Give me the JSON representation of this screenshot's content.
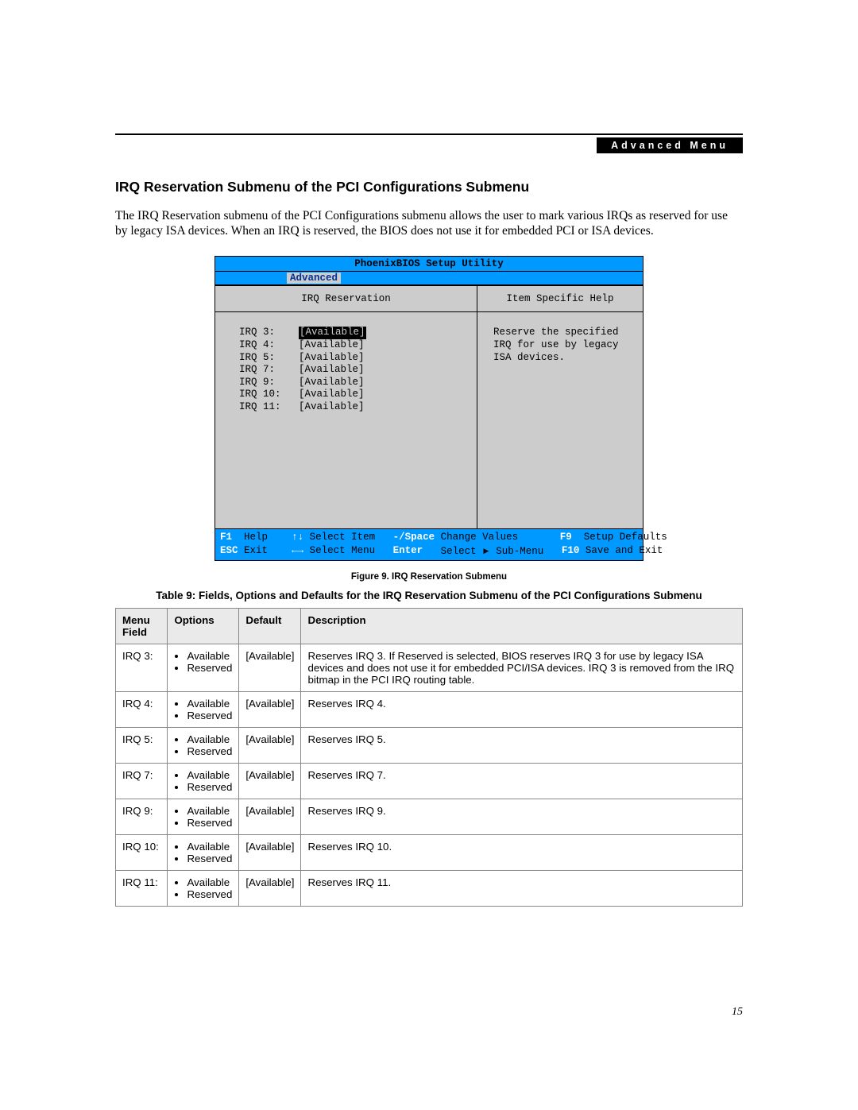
{
  "header_label": "Advanced Menu",
  "section_title": "IRQ Reservation Submenu of the PCI Configurations Submenu",
  "intro_text": "The IRQ Reservation submenu of the PCI Configurations submenu allows the user to mark various IRQs as reserved for use by legacy ISA devices. When an IRQ is reserved, the BIOS does not use it for embedded PCI or ISA devices.",
  "bios": {
    "title": "PhoenixBIOS Setup Utility",
    "active_tab": "Advanced",
    "left_header": "IRQ Reservation",
    "right_header": "Item Specific Help",
    "irq_rows": [
      {
        "label": "IRQ 3:",
        "value": "[Available]",
        "selected": true
      },
      {
        "label": "IRQ 4:",
        "value": "[Available]",
        "selected": false
      },
      {
        "label": "IRQ 5:",
        "value": "[Available]",
        "selected": false
      },
      {
        "label": "IRQ 7:",
        "value": "[Available]",
        "selected": false
      },
      {
        "label": "IRQ 9:",
        "value": "[Available]",
        "selected": false
      },
      {
        "label": "IRQ 10:",
        "value": "[Available]",
        "selected": false
      },
      {
        "label": "IRQ 11:",
        "value": "[Available]",
        "selected": false
      }
    ],
    "help_text": "Reserve the specified IRQ for use by legacy ISA devices.",
    "footer": {
      "f1": "F1",
      "help": "Help",
      "updown": "↑↓",
      "select_item": "Select Item",
      "minus_space": "-/Space",
      "change_values": "Change Values",
      "f9": "F9",
      "setup_defaults": "Setup Defaults",
      "esc": "ESC",
      "exit": "Exit",
      "leftright": "←→",
      "select_menu": "Select Menu",
      "enter": "Enter",
      "select_submenu": "Select    Sub-Menu",
      "f10": "F10",
      "save_exit": "Save and Exit"
    }
  },
  "figure_caption": "Figure 9.  IRQ Reservation Submenu",
  "table_caption": "Table 9: Fields, Options and Defaults for the IRQ Reservation Submenu of the PCI Configurations Submenu",
  "table": {
    "headers": [
      "Menu Field",
      "Options",
      "Default",
      "Description"
    ],
    "rows": [
      {
        "field": "IRQ 3:",
        "options": [
          "Available",
          "Reserved"
        ],
        "default": "[Available]",
        "desc": "Reserves IRQ 3. If Reserved is selected, BIOS reserves IRQ 3 for use by legacy ISA devices and does not use it for embedded PCI/ISA devices. IRQ 3 is removed from the IRQ bitmap in the PCI IRQ routing table."
      },
      {
        "field": "IRQ 4:",
        "options": [
          "Available",
          "Reserved"
        ],
        "default": "[Available]",
        "desc": "Reserves IRQ 4."
      },
      {
        "field": "IRQ 5:",
        "options": [
          "Available",
          "Reserved"
        ],
        "default": "[Available]",
        "desc": "Reserves IRQ 5."
      },
      {
        "field": "IRQ 7:",
        "options": [
          "Available",
          "Reserved"
        ],
        "default": "[Available]",
        "desc": "Reserves IRQ 7."
      },
      {
        "field": "IRQ 9:",
        "options": [
          "Available",
          "Reserved"
        ],
        "default": "[Available]",
        "desc": "Reserves IRQ 9."
      },
      {
        "field": "IRQ 10:",
        "options": [
          "Available",
          "Reserved"
        ],
        "default": "[Available]",
        "desc": "Reserves IRQ 10."
      },
      {
        "field": "IRQ 11:",
        "options": [
          "Available",
          "Reserved"
        ],
        "default": "[Available]",
        "desc": "Reserves IRQ 11."
      }
    ]
  },
  "page_number": "15"
}
